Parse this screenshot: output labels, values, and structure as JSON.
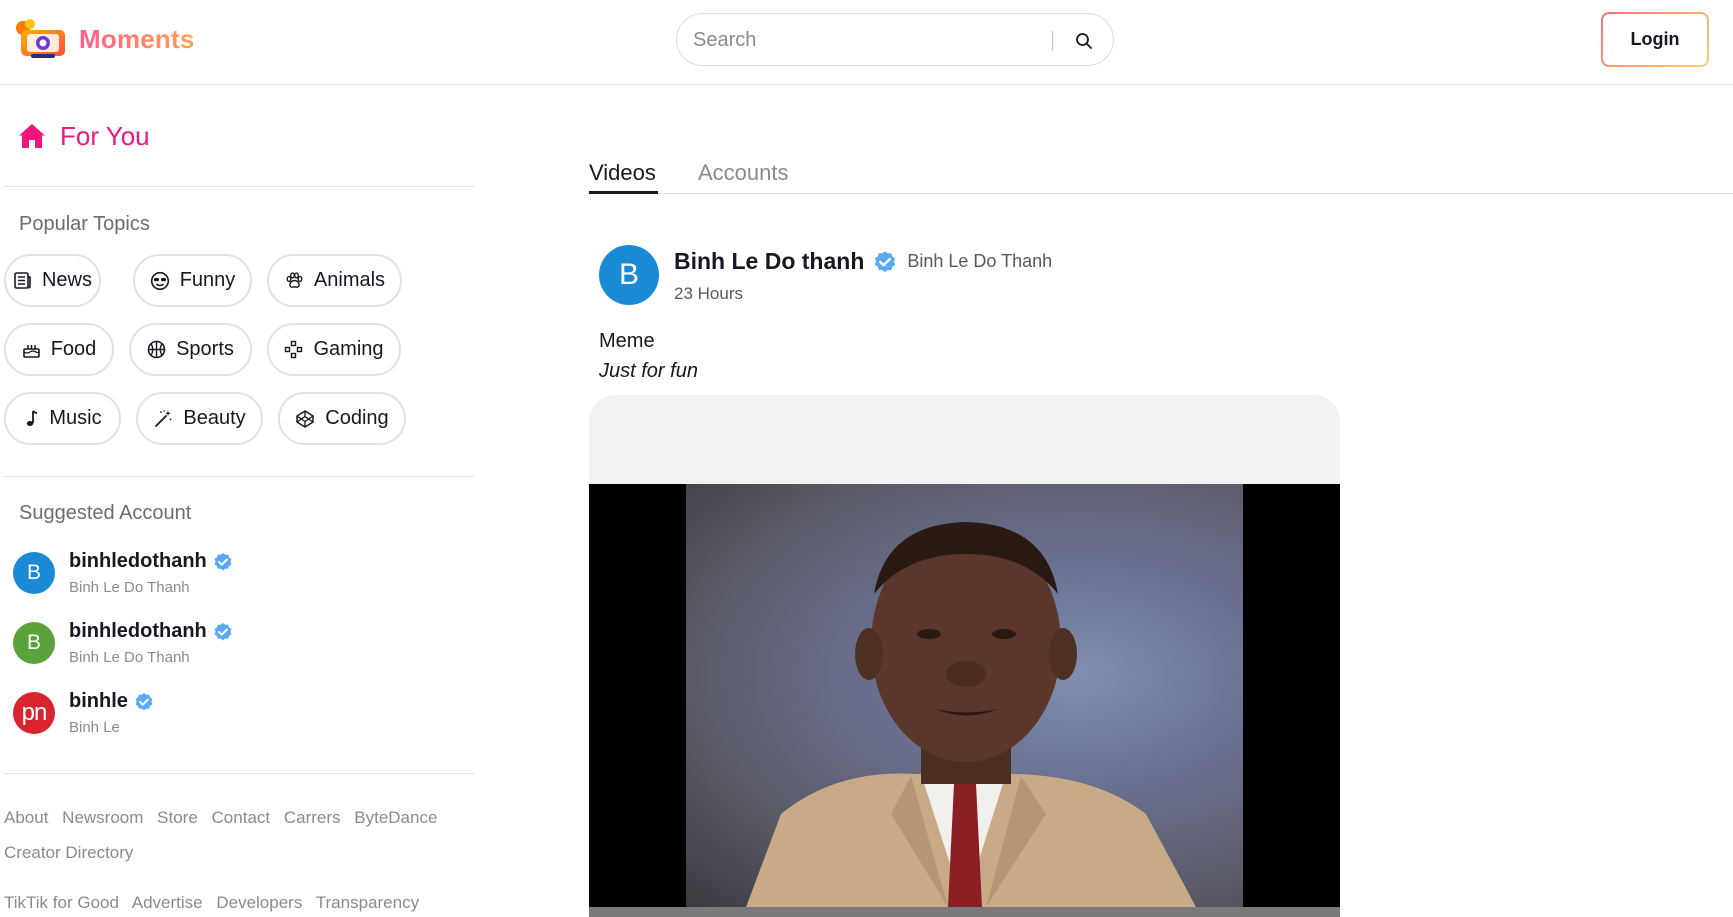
{
  "header": {
    "brand": "Moments",
    "search_placeholder": "Search",
    "login_label": "Login"
  },
  "sidebar": {
    "for_you": "For You",
    "popular_topics_title": "Popular Topics",
    "topics": [
      {
        "label": "News",
        "icon": "newspaper-icon"
      },
      {
        "label": "Funny",
        "icon": "sunglasses-face-icon"
      },
      {
        "label": "Animals",
        "icon": "paw-icon"
      },
      {
        "label": "Food",
        "icon": "cake-icon"
      },
      {
        "label": "Sports",
        "icon": "basketball-icon"
      },
      {
        "label": "Gaming",
        "icon": "gamepad-icon"
      },
      {
        "label": "Music",
        "icon": "music-note-icon"
      },
      {
        "label": "Beauty",
        "icon": "magic-wand-icon"
      },
      {
        "label": "Coding",
        "icon": "codepen-icon"
      }
    ],
    "suggested_title": "Suggested Account",
    "accounts": [
      {
        "username": "binhledothanh",
        "display_name": "Binh Le Do Thanh",
        "avatar_letter": "B",
        "avatar_color": "#1b8ad4"
      },
      {
        "username": "binhledothanh",
        "display_name": "Binh Le Do Thanh",
        "avatar_letter": "B",
        "avatar_color": "#5aa33a"
      },
      {
        "username": "binhle",
        "display_name": "Binh Le",
        "avatar_letter": "pn",
        "avatar_color": "#d9232e"
      }
    ],
    "footer_row1": [
      "About",
      "Newsroom",
      "Store",
      "Contact",
      "Carrers",
      "ByteDance"
    ],
    "footer_row2": [
      "Creator Directory"
    ],
    "footer_row3": [
      "TikTik for Good",
      "Advertise",
      "Developers",
      "Transparency"
    ]
  },
  "main": {
    "tabs": [
      "Videos",
      "Accounts"
    ],
    "active_tab": "Videos",
    "post": {
      "avatar_letter": "B",
      "author_name": "Binh Le Do thanh",
      "author_handle": "Binh Le Do Thanh",
      "time": "23 Hours",
      "title": "Meme",
      "subtitle": "Just for fun"
    }
  },
  "colors": {
    "accent_pink": "#f0167e",
    "verified_blue": "#20d5ec",
    "border": "#e3e3e4"
  }
}
